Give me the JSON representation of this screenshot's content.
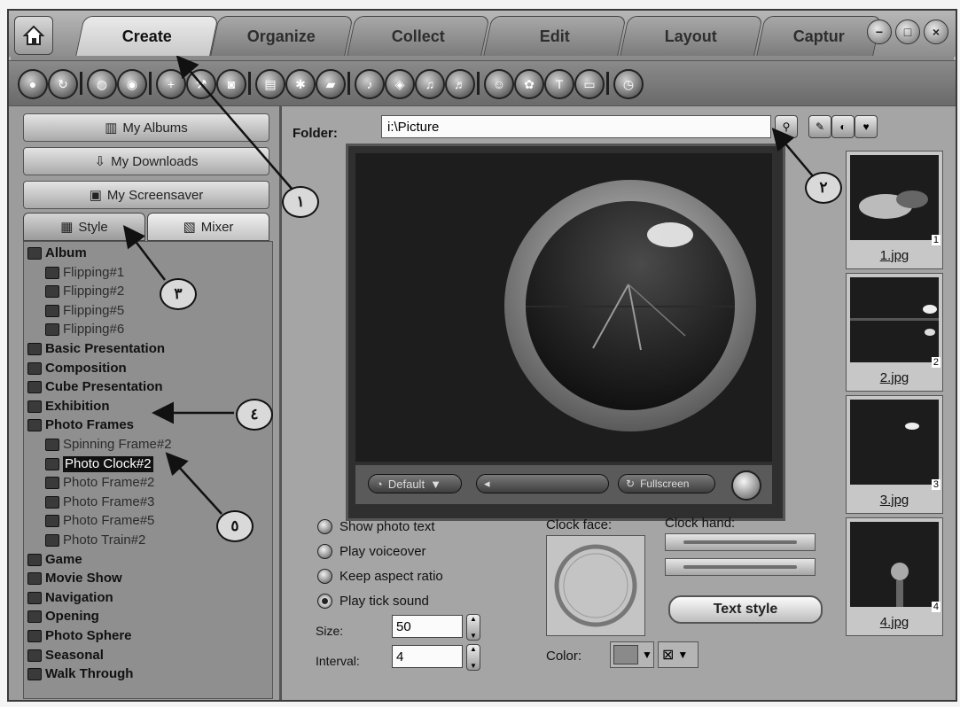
{
  "tabs": [
    {
      "label": "Create",
      "active": true
    },
    {
      "label": "Organize",
      "active": false
    },
    {
      "label": "Collect",
      "active": false
    },
    {
      "label": "Edit",
      "active": false
    },
    {
      "label": "Layout",
      "active": false
    },
    {
      "label": "Captur",
      "active": false
    }
  ],
  "window_buttons": [
    "minimize-icon",
    "maximize-icon",
    "close-icon"
  ],
  "left": {
    "buttons": [
      "My Albums",
      "My Downloads",
      "My Screensaver"
    ],
    "subtabs": [
      {
        "label": "Style",
        "active": true
      },
      {
        "label": "Mixer",
        "active": false
      }
    ],
    "tree": [
      {
        "label": "Album",
        "level": 0
      },
      {
        "label": "Flipping#1",
        "level": 1
      },
      {
        "label": "Flipping#2",
        "level": 1
      },
      {
        "label": "Flipping#5",
        "level": 1
      },
      {
        "label": "Flipping#6",
        "level": 1
      },
      {
        "label": "Basic Presentation",
        "level": 0
      },
      {
        "label": "Composition",
        "level": 0
      },
      {
        "label": "Cube Presentation",
        "level": 0
      },
      {
        "label": "Exhibition",
        "level": 0
      },
      {
        "label": "Photo Frames",
        "level": 0
      },
      {
        "label": "Spinning Frame#2",
        "level": 1
      },
      {
        "label": "Photo Clock#2",
        "level": 1,
        "selected": true
      },
      {
        "label": "Photo Frame#2",
        "level": 1
      },
      {
        "label": "Photo Frame#3",
        "level": 1
      },
      {
        "label": "Photo Frame#5",
        "level": 1
      },
      {
        "label": "Photo Train#2",
        "level": 1
      },
      {
        "label": "Game",
        "level": 0
      },
      {
        "label": "Movie Show",
        "level": 0
      },
      {
        "label": "Navigation",
        "level": 0
      },
      {
        "label": "Opening",
        "level": 0
      },
      {
        "label": "Photo Sphere",
        "level": 0
      },
      {
        "label": "Seasonal",
        "level": 0
      },
      {
        "label": "Walk Through",
        "level": 0
      }
    ]
  },
  "main": {
    "folder_label": "Folder:",
    "folder_value": "i:\\Picture",
    "preview_controls": {
      "mode": "Default",
      "fullscreen": "Fullscreen"
    },
    "options": [
      {
        "label": "Show photo text",
        "checked": false
      },
      {
        "label": "Play voiceover",
        "checked": false
      },
      {
        "label": "Keep aspect ratio",
        "checked": false
      },
      {
        "label": "Play tick sound",
        "checked": true
      }
    ],
    "size_label": "Size:",
    "size_value": "50",
    "interval_label": "Interval:",
    "interval_value": "4",
    "clock_face_label": "Clock face:",
    "clock_hand_label": "Clock hand:",
    "text_style_label": "Text style",
    "color_label": "Color:"
  },
  "thumbnails": [
    {
      "name": "1.jpg",
      "index": "1"
    },
    {
      "name": "2.jpg",
      "index": "2"
    },
    {
      "name": "3.jpg",
      "index": "3"
    },
    {
      "name": "4.jpg",
      "index": "4"
    }
  ],
  "annotations": [
    "١",
    "٢",
    "٣",
    "٤",
    "٥"
  ]
}
